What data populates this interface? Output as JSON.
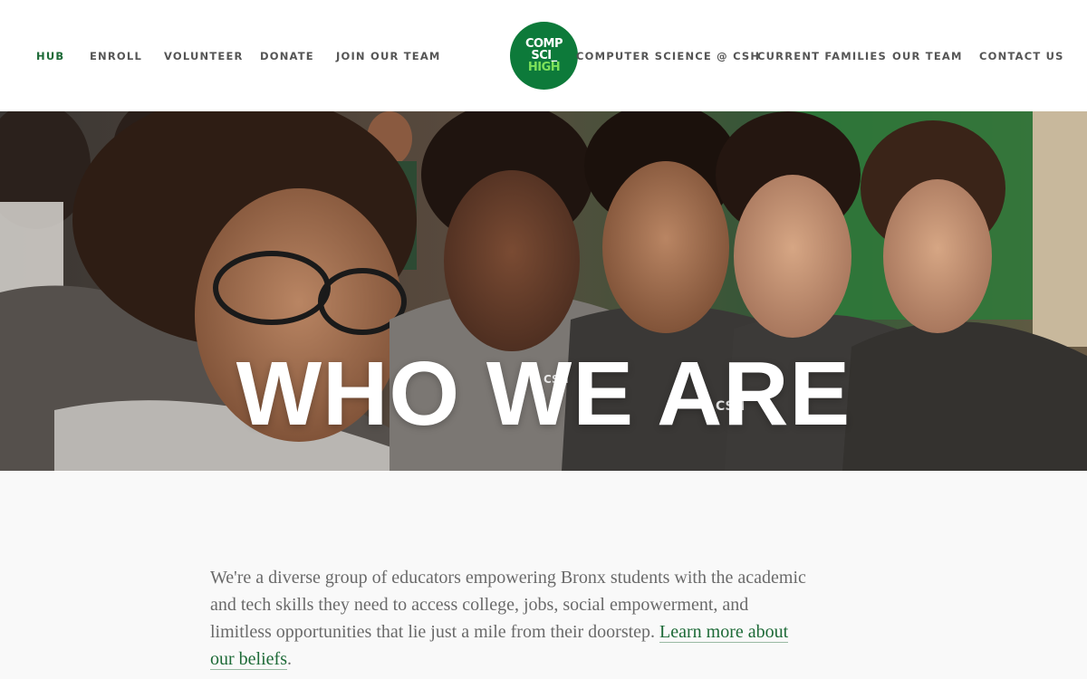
{
  "brand": {
    "logo_lines": [
      "COMP",
      "SCI_",
      "HIGH"
    ],
    "logo_color": "#0d7a3a",
    "accent_color": "#1d6a37",
    "logo_text_colors": [
      "#ffffff",
      "#ffffff",
      "#7ee15a"
    ]
  },
  "nav": {
    "left": [
      {
        "label": "HUB",
        "active": true
      },
      {
        "label": "ENROLL",
        "active": false
      },
      {
        "label": "VOLUNTEER",
        "active": false
      },
      {
        "label": "DONATE",
        "active": false
      },
      {
        "label": "JOIN OUR TEAM",
        "active": false
      }
    ],
    "right": [
      {
        "label": "COMPUTER SCIENCE @ CSH",
        "active": false
      },
      {
        "label": "CURRENT FAMILIES",
        "active": false
      },
      {
        "label": "OUR TEAM",
        "active": false
      },
      {
        "label": "CONTACT US",
        "active": false
      }
    ]
  },
  "hero": {
    "title": "WHO WE ARE"
  },
  "intro": {
    "text": "We're a diverse group of educators empowering Bronx students with the academic and tech skills they need to access college, jobs, social empowerment, and limitless opportunities that lie just a mile from their doorstep.",
    "link_text": "Learn more about our beliefs",
    "trailing": "."
  }
}
